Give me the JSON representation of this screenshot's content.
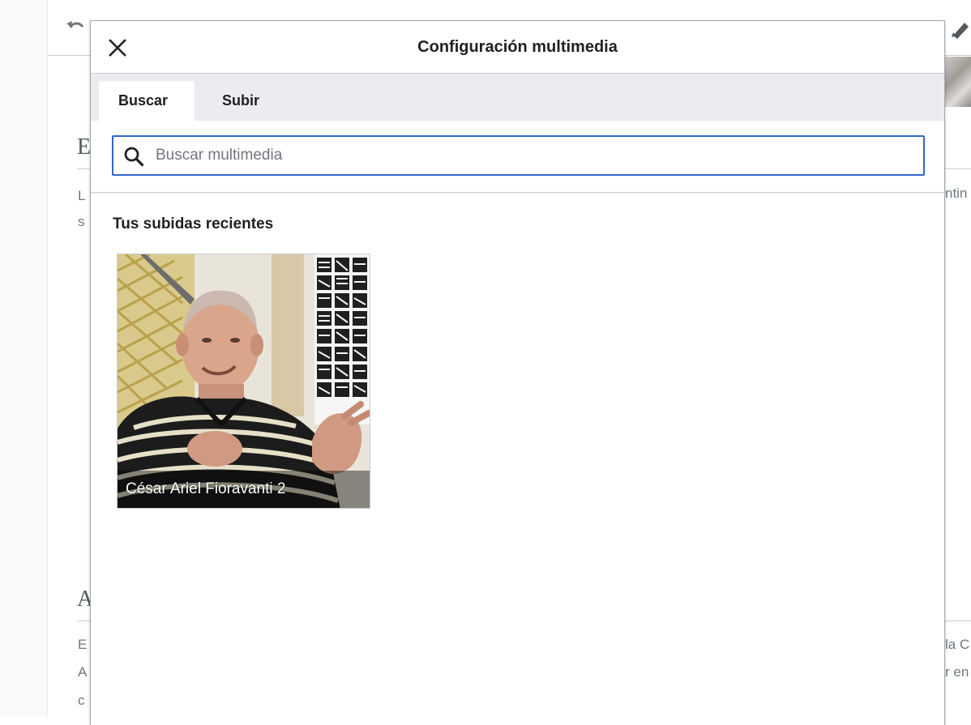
{
  "dialog": {
    "title": "Configuración multimedia",
    "close_icon": "close-icon"
  },
  "tabs": [
    {
      "label": "Buscar",
      "active": true
    },
    {
      "label": "Subir",
      "active": false
    }
  ],
  "search": {
    "placeholder": "Buscar multimedia",
    "value": "",
    "icon": "search-icon",
    "accent": "#3366cc"
  },
  "recent": {
    "title": "Tus subidas recientes",
    "items": [
      {
        "caption": "César Ariel Fioravanti 2"
      }
    ]
  },
  "background": {
    "heading_1": "E",
    "heading_2": "A",
    "para_1_line_1": "L",
    "para_1_line_2": "s",
    "para_1_right": "ntin",
    "para_2_line_1": "E",
    "para_2_line_2": "A",
    "para_2_line_3": "c",
    "para_2_right_1": "la C",
    "para_2_right_2": "r en",
    "undo_icon": "undo-icon",
    "edit_icon": "pencil-icon"
  }
}
